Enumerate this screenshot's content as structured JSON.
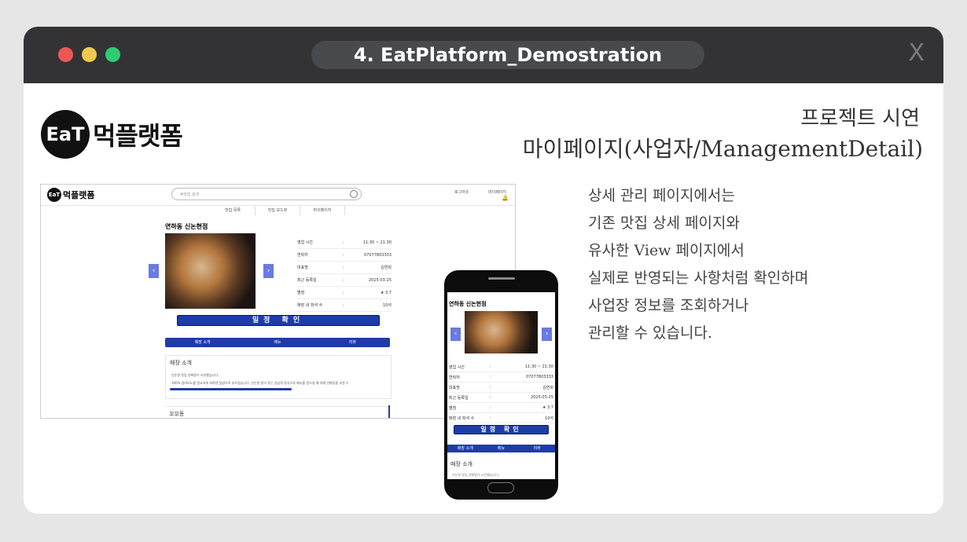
{
  "window": {
    "title": "4. EatPlatform_Demostration",
    "close_label": "X"
  },
  "logo": {
    "mark": "EaT",
    "name": "먹플랫폼"
  },
  "header": {
    "line1": "프로젝트 시연",
    "line2": "마이페이지(사업자/ManagementDetail)"
  },
  "description": [
    "상세 관리 페이지에서는",
    "기존 맛집 상세 페이지와",
    "유사한 View 페이지에서",
    "실제로 반영되는 사항처럼 확인하며",
    "사업장 정보를 조회하거나",
    "관리할 수 있습니다."
  ],
  "desktop": {
    "logo_name": "먹플랫폼",
    "search_placeholder": "#맛집 검색",
    "login": "로그아웃",
    "mypage": "마이페이지",
    "nav": [
      "맛집 목록",
      "맛집 모드뷰",
      "마이페이지"
    ],
    "store_name": "연하동 신논현점",
    "info": [
      {
        "key": "영업 시간",
        "sep": ":",
        "value": "11:30 ~ 21:30"
      },
      {
        "key": "연락처",
        "sep": ":",
        "value": "07077803333"
      },
      {
        "key": "대표명",
        "sep": ":",
        "value": "김연희"
      },
      {
        "key": "최근 등록일",
        "sep": ":",
        "value": "2025-03-25"
      },
      {
        "key": "별점",
        "sep": ":",
        "value": "★ 3.7"
      },
      {
        "key": "매장 내 좌석 수",
        "sep": ":",
        "value": "10석"
      }
    ],
    "schedule_button": "일정 확인",
    "tabs": [
      "매장 소개",
      "메뉴",
      "리뷰"
    ],
    "intro_title": "매장 소개",
    "intro_line1": "신논현 맛집 연화동이 오픈했습니다.",
    "intro_line2": "100% 참마모노를 정교하게 저며낸 덮밥으로 부드럽습니다. 신논현 정식 후는 감남역 정식으로 메뉴를 받으실 때 차례 연화동을 추천 드",
    "next_title": "꼬꼬동"
  },
  "mobile": {
    "store_name": "연하동 신논현점",
    "info": [
      {
        "key": "영업 시간",
        "sep": ":",
        "value": "11:30 ~ 21:30"
      },
      {
        "key": "연락처",
        "sep": ":",
        "value": "07077803333"
      },
      {
        "key": "대표명",
        "sep": ":",
        "value": "김연희"
      },
      {
        "key": "최근 등록일",
        "sep": ":",
        "value": "2025-03-25"
      },
      {
        "key": "별점",
        "sep": ":",
        "value": "★ 3.7"
      },
      {
        "key": "매장 내 좌석 수",
        "sep": ":",
        "value": "10석"
      }
    ],
    "schedule_button": "일정 확인",
    "tabs": [
      "매장 소개",
      "메뉴",
      "리뷰"
    ],
    "intro_title": "매장 소개",
    "intro_line1": "신논현 맛집 연화동이 오픈했습니다."
  },
  "colors": {
    "titlebar": "#333335",
    "accent_blue": "#1e3ca8",
    "arrow_button": "#6a7ae0"
  }
}
